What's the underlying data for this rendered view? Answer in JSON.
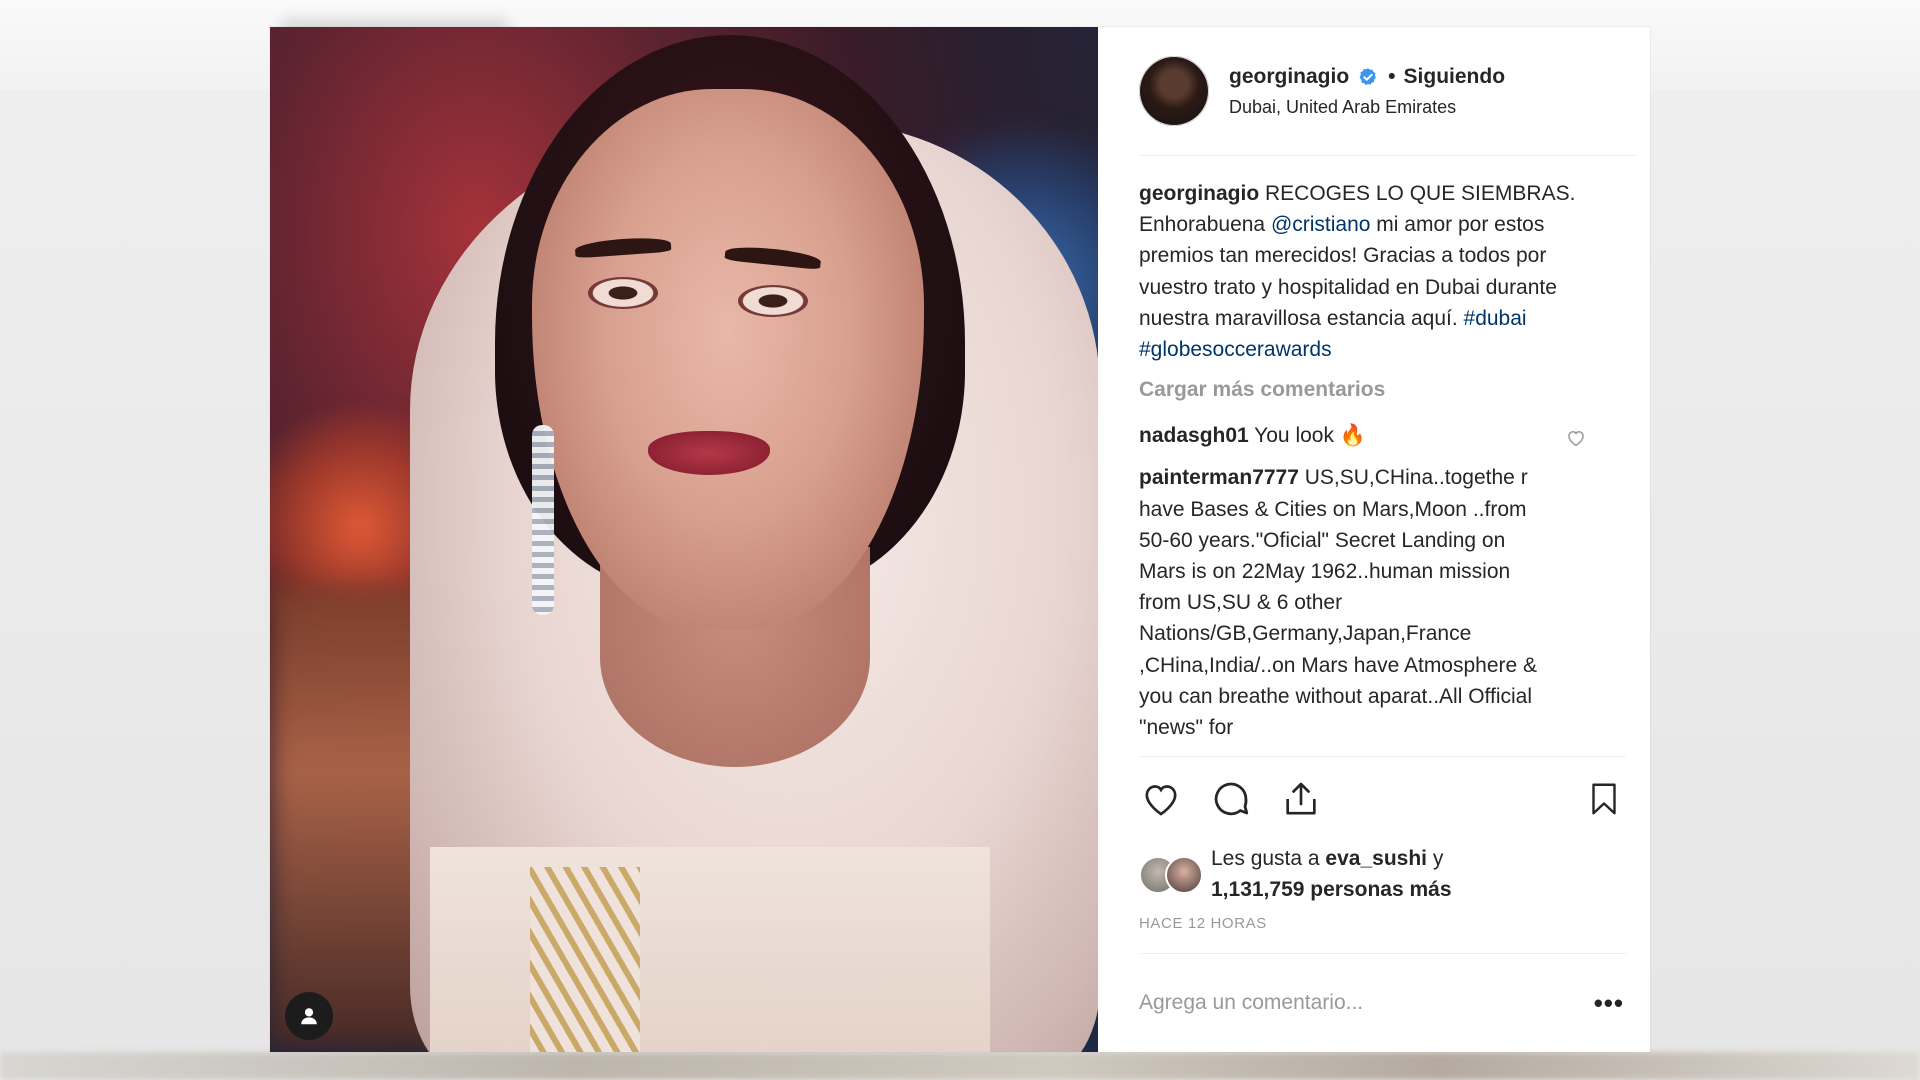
{
  "post": {
    "username": "georginagio",
    "follow_status": "Siguiendo",
    "location": "Dubai, United Arab Emirates",
    "caption": {
      "author": "georginagio",
      "text_1": " RECOGES LO QUE SIEMBRAS. Enhorabuena ",
      "mention": "@cristiano",
      "text_2": " mi amor por estos premios tan merecidos! Gracias a todos por vuestro trato y hospitalidad en Dubai durante nuestra maravillosa estancia aquí. ",
      "hashtag_1": "#dubai",
      "hashtag_2": "#globesoccerawards"
    },
    "load_more_label": "Cargar más comentarios",
    "comments": [
      {
        "author": "nadasgh01",
        "text": " You look 🔥"
      },
      {
        "author": "painterman7777",
        "text": " US,SU,CHina..togethe r have Bases & Cities on Mars,Moon ..from 50-60 years.\"Oficial\" Secret Landing on Mars is on 22May 1962..human mission from US,SU & 6 other Nations/GB,Germany,Japan,France ,CHina,India/..on Mars have Atmosphere & you can breathe without aparat..All Official \"news\" for"
      }
    ],
    "likes": {
      "prefix": "Les gusta a ",
      "liker": "eva_sushi",
      "mid": " y",
      "count_text": "1,131,759 personas más"
    },
    "timestamp": "HACE 12 HORAS",
    "add_comment_placeholder": "Agrega un comentario...",
    "more_label": "•••"
  },
  "icons": {
    "verified": "verified-badge-icon",
    "like": "heart-icon",
    "comment": "comment-icon",
    "share": "share-icon",
    "save": "bookmark-icon",
    "tagged_user": "user-tag-icon"
  },
  "colors": {
    "verified_blue": "#3897f0",
    "link_blue": "#003569",
    "muted_gray": "#999999",
    "text": "#262626"
  }
}
